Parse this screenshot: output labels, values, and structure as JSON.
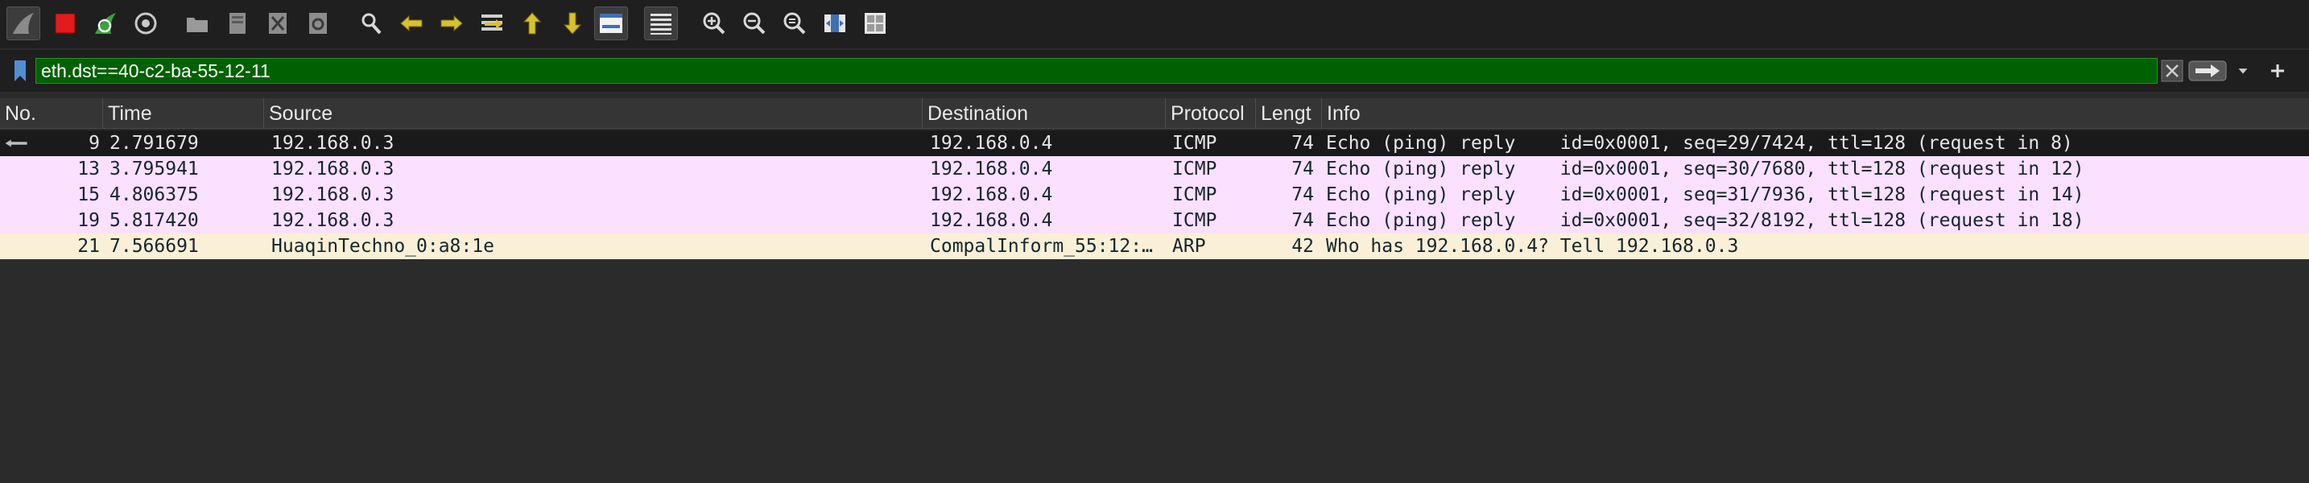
{
  "toolbar": {
    "icons": [
      "shark-fin-start-icon",
      "stop-capture-icon",
      "restart-capture-icon",
      "capture-options-icon",
      "open-file-icon",
      "save-file-icon",
      "close-file-icon",
      "reload-file-icon",
      "find-packet-icon",
      "go-back-icon",
      "go-forward-icon",
      "go-to-packet-icon",
      "first-packet-icon",
      "last-packet-icon",
      "auto-scroll-icon",
      "colorize-icon",
      "zoom-in-icon",
      "zoom-out-icon",
      "normal-size-icon",
      "resize-columns-icon",
      "layout-icon"
    ]
  },
  "filter": {
    "value": "eth.dst==40-c2-ba-55-12-11",
    "color": "#006100"
  },
  "columns": [
    "No.",
    "Time",
    "Source",
    "Destination",
    "Protocol",
    "Lengt",
    "Info"
  ],
  "packets": [
    {
      "no": "9",
      "time": "2.791679",
      "source": "192.168.0.3",
      "destination": "192.168.0.4",
      "protocol": "ICMP",
      "length": "74",
      "info": "Echo (ping) reply    id=0x0001, seq=29/7424, ttl=128 (request in 8)"
    },
    {
      "no": "13",
      "time": "3.795941",
      "source": "192.168.0.3",
      "destination": "192.168.0.4",
      "protocol": "ICMP",
      "length": "74",
      "info": "Echo (ping) reply    id=0x0001, seq=30/7680, ttl=128 (request in 12)"
    },
    {
      "no": "15",
      "time": "4.806375",
      "source": "192.168.0.3",
      "destination": "192.168.0.4",
      "protocol": "ICMP",
      "length": "74",
      "info": "Echo (ping) reply    id=0x0001, seq=31/7936, ttl=128 (request in 14)"
    },
    {
      "no": "19",
      "time": "5.817420",
      "source": "192.168.0.3",
      "destination": "192.168.0.4",
      "protocol": "ICMP",
      "length": "74",
      "info": "Echo (ping) reply    id=0x0001, seq=32/8192, ttl=128 (request in 18)"
    },
    {
      "no": "21",
      "time": "7.566691",
      "source": "HuaqinTechno_0:a8:1e",
      "destination": "CompalInform_55:12:…",
      "protocol": "ARP",
      "length": "42",
      "info": "Who has 192.168.0.4? Tell 192.168.0.3"
    }
  ],
  "colors": {
    "icmp_row": "#fce0ff",
    "arp_row": "#faf0d7",
    "selected_row": "#1a1a1a"
  }
}
